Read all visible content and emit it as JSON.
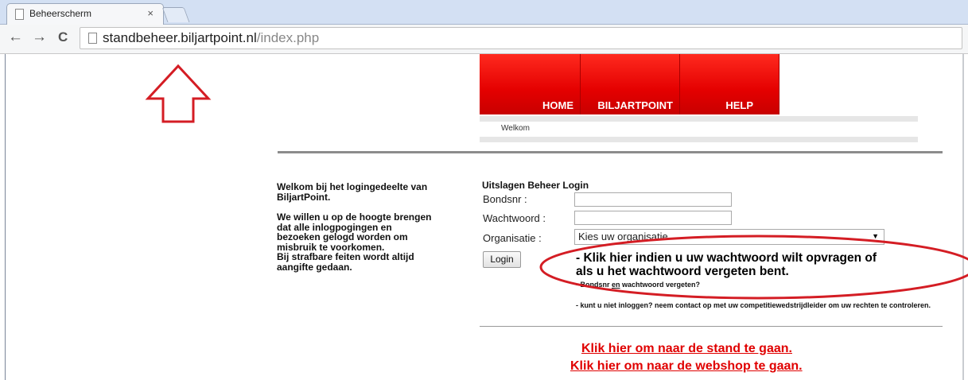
{
  "browser": {
    "tab_title": "Beheerscherm",
    "tab_close": "×",
    "url_host": "standbeheer.biljartpoint.nl",
    "url_path": "/index.php",
    "back": "←",
    "forward": "→",
    "reload": "C"
  },
  "nav": {
    "items": [
      {
        "label": "HOME"
      },
      {
        "label": "BILJARTPOINT"
      },
      {
        "label": "HELP"
      }
    ],
    "submenu": "Welkom"
  },
  "welcome": {
    "p1": "Welkom bij het logingedeelte van BiljartPoint.",
    "p2a": "We willen u op de hoogte brengen dat alle inlogpogingen en bezoeken gelogd worden om misbruik te voorkomen.",
    "p2b": "Bij strafbare feiten wordt altijd aangifte gedaan."
  },
  "login": {
    "title": "Uitslagen Beheer Login",
    "bondsnr_label": "Bondsnr :",
    "wachtwoord_label": "Wachtwoord :",
    "organisatie_label": "Organisatie :",
    "organisatie_value": "Kies uw organisatie",
    "submit": "Login"
  },
  "help": {
    "big_line1": "- Klik hier indien u uw wachtwoord wilt opvragen of",
    "big_line2": "als u het wachtwoord vergeten bent.",
    "small_pre": "- Bondsnr ",
    "small_and": "en",
    "small_post": " wachtwoord vergeten?",
    "contact": "- kunt u niet inloggen? neem contact op met uw competitiewedstrijdleider om uw rechten te controleren."
  },
  "links": {
    "stand": "Klik hier om naar de stand te gaan. ",
    "webshop": "Klik hier om naar de webshop te gaan."
  },
  "colors": {
    "menu_red": "#e40000",
    "link_red": "#e00000",
    "annotation_red": "#d41d24"
  }
}
